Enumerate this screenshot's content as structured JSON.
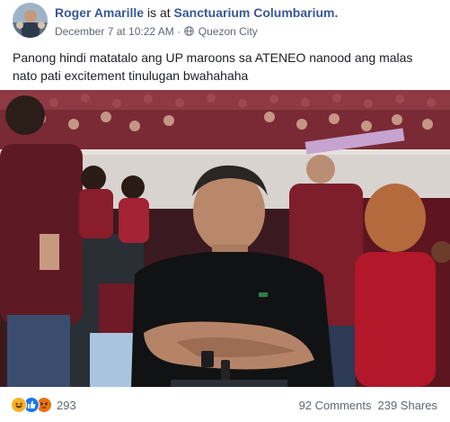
{
  "post": {
    "author_name": "Roger Amarille",
    "verb": "is at",
    "place_name": "Sanctuarium Columbarium.",
    "date": "December 7 at 10:22 AM",
    "separator": "·",
    "location": "Quezon City",
    "caption": "Panong hindi matatalo ang UP maroons sa ATENEO nanood ang malas nato pati excitement tinulugan bwahahaha"
  },
  "footer": {
    "reaction_icons": [
      "haha-icon",
      "like-icon",
      "angry-icon"
    ],
    "reaction_count": "293",
    "comments": "92 Comments",
    "shares": "239 Shares"
  },
  "colors": {
    "link_blue": "#385898",
    "meta_gray": "#606770",
    "like_blue": "#1877f2",
    "haha_yellow": "#f7b125",
    "angry_orange": "#e9710f"
  }
}
